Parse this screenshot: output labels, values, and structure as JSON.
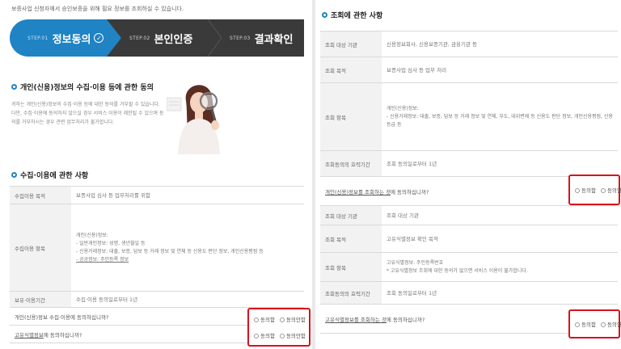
{
  "left": {
    "top_note": "보증사업 신청자께서 승인보증을 위해 필요 정보를 조회하실 수 있습니다.",
    "steps": [
      {
        "num": "STEP.01",
        "name": "정보동의",
        "active": true
      },
      {
        "num": "STEP.02",
        "name": "본인인증",
        "active": false
      },
      {
        "num": "STEP.03",
        "name": "결과확인",
        "active": false
      }
    ],
    "consent_title": "개인(신용)정보의 수집·이용 등에 관한 동의",
    "consent_paragraph": "귀하는 개인(신용)정보의 수집·이용 등에 대한 동의를 거부할 수 있습니다. 다만, 수집·이용에 동의하지 않으실 경우 서비스 이용이 제한될 수 있으며 동의를 거부하시는 경우 관련 업무처리가 불가합니다.",
    "collect_title": "수집·이용에 관한 사항",
    "table": [
      {
        "key": "수집이용 목적",
        "value": "보증사업 심사 등 업무처리를 위함"
      },
      {
        "key": "수집이용 항목",
        "lines": [
          "개인(신용)정보:",
          "- 일반개인정보: 성명, 생년월일 등",
          "- 신용거래정보: 대출, 보증, 담보 등 거래 정보 및 연체 등 신용도 판단 정보, 개인신용평점 등",
          "- 공공정보: 주민등록 정보"
        ]
      },
      {
        "key": "보유·이용기간",
        "value": "수집·이용 동의일로부터 1년"
      }
    ],
    "agree_rows": [
      {
        "text": "개인(신용)정보 수집·이용에 동의하십니까?",
        "link": ""
      },
      {
        "text": "에 동의하십니까?",
        "link": "고유식별정보"
      }
    ],
    "radio_agree": "동의함",
    "radio_disagree": "동의안함"
  },
  "right": {
    "title": "조회에 관한 사항",
    "table1": [
      {
        "key": "조회 대상 기관",
        "value": "신용정보회사, 신용보증기관, 금융기관 등"
      },
      {
        "key": "조회 목적",
        "value": "보증사업 심사 등 업무 처리"
      },
      {
        "key": "조회 항목",
        "lines": [
          "개인(신용)정보:",
          "- 신용거래정보: 대출, 보증, 담보 등 거래 정보 및 연체, 부도, 대위변제 등 신용도 판단 정보, 개인신용평점, 신용등급 등"
        ]
      },
      {
        "key": "조회동의의 효력기간",
        "value": "조회 동의일로부터 1년"
      }
    ],
    "agree1_text": "에 동의하십니까?",
    "agree1_link": "개인(신용)정보를 조회하는 것",
    "table2": [
      {
        "key": "조회 대상 기관",
        "value": "조회 대상 기관"
      },
      {
        "key": "조회 목적",
        "value": "고유식별정보 확인 목적"
      },
      {
        "key": "조회 항목",
        "lines": [
          "고유식별정보: 주민등록번호",
          "* 고유식별정보 조회에 대한 동의가 없으면 서비스 이용이 불가합니다."
        ]
      },
      {
        "key": "조회동의의 효력기간",
        "value": "조회 동의일로부터 1년"
      }
    ],
    "agree2_text": "에 동의하십니까?",
    "agree2_link": "고유식별정보를 조회하는 것",
    "radio_agree": "동의함",
    "radio_disagree": "동의안함"
  },
  "colors": {
    "dark": "#3a3a3a",
    "accent": "#1f83c4",
    "highlight": "#d8121b"
  }
}
